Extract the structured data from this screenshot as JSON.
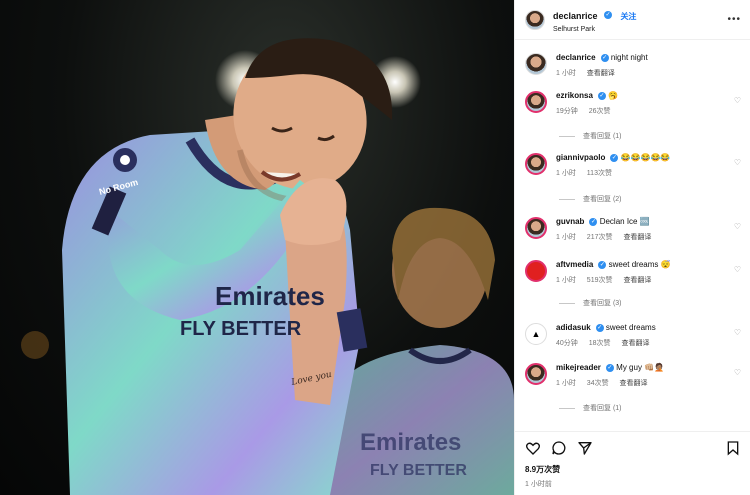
{
  "post": {
    "author": "declanrice",
    "follow_label": "关注",
    "location": "Selhurst Park",
    "more_label": "•••"
  },
  "photo": {
    "sponsor_line1": "Emirates",
    "sponsor_line2": "FLY BETTER",
    "tattoo_text": "Love you",
    "badge_text": "No Room"
  },
  "caption": {
    "user": "declanrice",
    "text": "night night",
    "time": "1 小时",
    "translate": "查看翻译"
  },
  "comments": [
    {
      "user": "ezrikonsa",
      "text": "🥱",
      "time": "19分钟",
      "likes": "26次赞",
      "reply": "",
      "translate": "",
      "replies": "查看回复 (1)"
    },
    {
      "user": "giannivpaolo",
      "text": "😂😂😂😂😂",
      "time": "1 小时",
      "likes": "113次赞",
      "reply": "",
      "translate": "",
      "replies": "查看回复 (2)"
    },
    {
      "user": "guvnab",
      "text": "Declan Ice 🆒",
      "time": "1 小时",
      "likes": "217次赞",
      "reply": "",
      "translate": "查看翻译",
      "replies": ""
    },
    {
      "user": "aftvmedia",
      "text": "sweet dreams 😴",
      "time": "1 小时",
      "likes": "519次赞",
      "reply": "",
      "translate": "查看翻译",
      "replies": "查看回复 (3)"
    },
    {
      "user": "adidasuk",
      "text": "sweet dreams",
      "time": "40分钟",
      "likes": "18次赞",
      "reply": "",
      "translate": "查看翻译",
      "replies": ""
    },
    {
      "user": "mikejreader",
      "text": "My guy 👊🏼🤦🏽",
      "time": "1 小时",
      "likes": "34次赞",
      "reply": "",
      "translate": "查看翻译",
      "replies": "查看回复 (1)"
    }
  ],
  "footer": {
    "likes": "8.9万次赞",
    "time": "1 小时前"
  },
  "colors": {
    "accent": "#1877f2",
    "verified": "#2f8ff0",
    "kit_teal": "#7fd9c8",
    "kit_purple": "#9b8fe0"
  }
}
